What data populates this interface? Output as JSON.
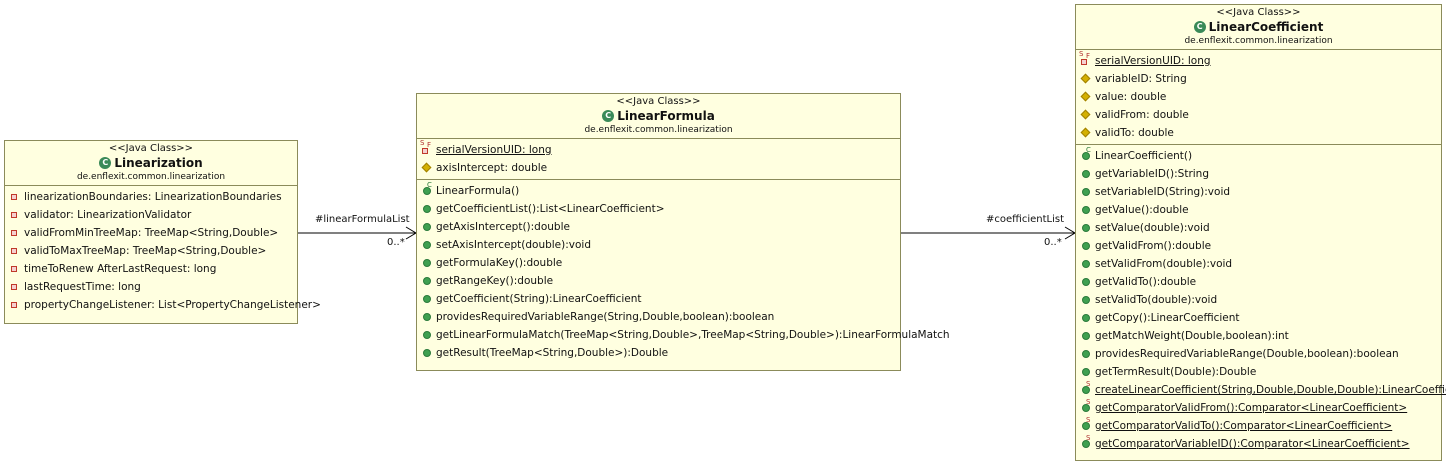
{
  "stereotype": "<<Java Class>>",
  "package": "de.enflexit.common.linearization",
  "classes": {
    "linearization": {
      "name": "Linearization",
      "attributes": [
        "linearizationBoundaries: LinearizationBoundaries",
        "validator: LinearizationValidator",
        "validFromMinTreeMap: TreeMap<String,Double>",
        "validToMaxTreeMap: TreeMap<String,Double>",
        "timeToRenew AfterLastRequest: long",
        "lastRequestTime: long",
        "propertyChangeListener: List<PropertyChangeListener>"
      ]
    },
    "linearFormula": {
      "name": "LinearFormula",
      "attributes": [
        "serialVersionUID: long",
        "axisIntercept: double"
      ],
      "methods": [
        "LinearFormula()",
        "getCoefficientList():List<LinearCoefficient>",
        "getAxisIntercept():double",
        "setAxisIntercept(double):void",
        "getFormulaKey():double",
        "getRangeKey():double",
        "getCoefficient(String):LinearCoefficient",
        "providesRequiredVariableRange(String,Double,boolean):boolean",
        "getLinearFormulaMatch(TreeMap<String,Double>,TreeMap<String,Double>):LinearFormulaMatch",
        "getResult(TreeMap<String,Double>):Double"
      ]
    },
    "linearCoefficient": {
      "name": "LinearCoefficient",
      "attributes": [
        "serialVersionUID: long",
        "variableID: String",
        "value: double",
        "validFrom: double",
        "validTo: double"
      ],
      "methods": [
        "LinearCoefficient()",
        "getVariableID():String",
        "setVariableID(String):void",
        "getValue():double",
        "setValue(double):void",
        "getValidFrom():double",
        "setValidFrom(double):void",
        "getValidTo():double",
        "setValidTo(double):void",
        "getCopy():LinearCoefficient",
        "getMatchWeight(Double,boolean):int",
        "providesRequiredVariableRange(Double,boolean):boolean",
        "getTermResult(Double):Double",
        "createLinearCoefficient(String,Double,Double,Double):LinearCoefficient",
        "getComparatorValidFrom():Comparator<LinearCoefficient>",
        "getComparatorValidTo():Comparator<LinearCoefficient>",
        "getComparatorVariableID():Comparator<LinearCoefficient>"
      ]
    }
  },
  "associations": {
    "linearFormulaList": {
      "role": "#linearFormulaList",
      "multiplicity": "0..*"
    },
    "coefficientList": {
      "role": "#coefficientList",
      "multiplicity": "0..*"
    }
  }
}
